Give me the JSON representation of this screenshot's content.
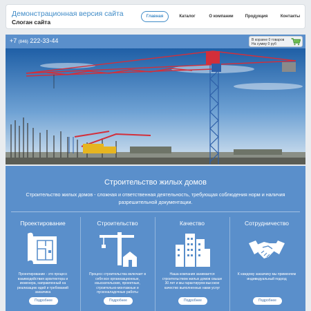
{
  "header": {
    "site_title": "Демонстрационная версия сайта",
    "slogan": "Слоган сайта",
    "nav": [
      {
        "label": "Главная",
        "active": true
      },
      {
        "label": "Каталог",
        "active": false
      },
      {
        "label": "О компании",
        "active": false
      },
      {
        "label": "Продукция",
        "active": false
      },
      {
        "label": "Контакты",
        "active": false
      }
    ]
  },
  "contact_bar": {
    "phone_prefix": "+7",
    "phone_code": "(846)",
    "phone_number": "222-33-44",
    "cart_line1": "В корзине 0 товаров",
    "cart_line2": "На сумму 0 руб"
  },
  "hero": {
    "image_subject": "tower cranes and concrete pump on construction site"
  },
  "section": {
    "title": "Строительство жилых домов",
    "description": "Строительство жилых домов - сложная и ответственная деятельность, требующая соблюдения норм и наличия разрешительной документации."
  },
  "features": [
    {
      "title": "Проектирование",
      "icon": "blueprint-icon",
      "text": "Проектирование - это процесс взаимодействия архитектора и инженера, направленный на реализацию идей и требований заказчика",
      "button": "Подробнее"
    },
    {
      "title": "Строительство",
      "icon": "crane-house-icon",
      "text": "Процесс строительства включает в себя все организационные, изыскательские, проектные, строительно-монтажные и пусконаладочные работы",
      "button": "Подробнее"
    },
    {
      "title": "Качество",
      "icon": "buildings-icon",
      "text": "Наша компания занимается строительством жилых домов свыше 30 лет и мы гарантируем высокое качество выполненных нами услуг",
      "button": "Подробнее"
    },
    {
      "title": "Сотрудничество",
      "icon": "handshake-icon",
      "text": "К каждому заказчику мы применяем индивидуальный подход",
      "button": "Подробнее"
    }
  ],
  "colors": {
    "accent": "#5a8fcb",
    "link": "#3f8bc7",
    "crane_red": "#d32f3a",
    "crane_blue": "#2d5fa8"
  }
}
